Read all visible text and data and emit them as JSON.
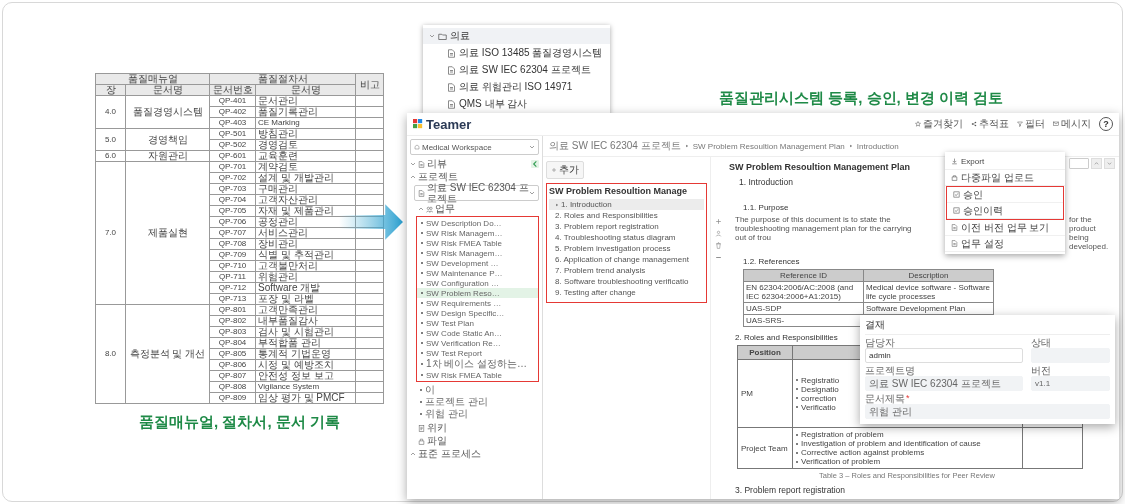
{
  "document_table": {
    "header_groups": [
      "품질매뉴얼",
      "품질절차서",
      "비고"
    ],
    "columns": [
      "장",
      "문서명",
      "문서번호",
      "문서명"
    ],
    "groups": [
      {
        "chapter": "4.0",
        "name": "품질경영시스템",
        "procedures": [
          {
            "number": "QP-401",
            "title": "문서관리"
          },
          {
            "number": "QP-402",
            "title": "품질기록관리"
          },
          {
            "number": "QP-403",
            "title": "CE Marking"
          }
        ]
      },
      {
        "chapter": "5.0",
        "name": "경영책임",
        "procedures": [
          {
            "number": "QP-501",
            "title": "방침관리"
          },
          {
            "number": "QP-502",
            "title": "경영검토"
          }
        ]
      },
      {
        "chapter": "6.0",
        "name": "자원관리",
        "procedures": [
          {
            "number": "QP-601",
            "title": "교육훈련"
          }
        ]
      },
      {
        "chapter": "7.0",
        "name": "제품실현",
        "procedures": [
          {
            "number": "QP-701",
            "title": "계약검토"
          },
          {
            "number": "QP-702",
            "title": "설계 및 개발관리"
          },
          {
            "number": "QP-703",
            "title": "구매관리"
          },
          {
            "number": "QP-704",
            "title": "고객자산관리"
          },
          {
            "number": "QP-705",
            "title": "자재 및 제품관리"
          },
          {
            "number": "QP-706",
            "title": "공정관리"
          },
          {
            "number": "QP-707",
            "title": "서비스관리"
          },
          {
            "number": "QP-708",
            "title": "장비관리"
          },
          {
            "number": "QP-709",
            "title": "식별 및 추적관리"
          },
          {
            "number": "QP-710",
            "title": "고객불만처리"
          },
          {
            "number": "QP-711",
            "title": "위험관리"
          },
          {
            "number": "QP-712",
            "title": "Software 개발"
          },
          {
            "number": "QP-713",
            "title": "포장 및 라벨"
          }
        ]
      },
      {
        "chapter": "8.0",
        "name": "측정분석 및 개선",
        "procedures": [
          {
            "number": "QP-801",
            "title": "고객만족관리"
          },
          {
            "number": "QP-802",
            "title": "내부품질감사"
          },
          {
            "number": "QP-803",
            "title": "검사 및 시험관리"
          },
          {
            "number": "QP-804",
            "title": "부적합품 관리"
          },
          {
            "number": "QP-805",
            "title": "통계적 기법운영"
          },
          {
            "number": "QP-806",
            "title": "시정 및 예방조치"
          },
          {
            "number": "QP-807",
            "title": "안전성 정보 보고"
          },
          {
            "number": "QP-808",
            "title": "Vigilance System"
          },
          {
            "number": "QP-809",
            "title": "임상 평가 및 PMCF"
          }
        ]
      }
    ]
  },
  "caption": "품질매뉴얼, 절차서, 문서 기록",
  "folder_popup": {
    "label": "의료",
    "expanded": true,
    "files": [
      "의료 ISO 13485 품질경영시스템",
      "의료 SW IEC 62304 프로젝트",
      "의료 위험관리 ISO 14971",
      "QMS 내부 감사"
    ]
  },
  "headline": "품질관리시스템 등록, 승인, 변경 이력 검토",
  "app": {
    "logo": "Teamer",
    "header_actions": [
      {
        "label": "즐겨찾기",
        "kind": "star"
      },
      {
        "label": "추적표",
        "kind": "share"
      },
      {
        "label": "필터",
        "kind": "filter"
      },
      {
        "label": "메시지",
        "kind": "message"
      }
    ],
    "help": "?",
    "sidebar": {
      "workspace": "Medical Workspace",
      "review": {
        "label": "리뷰",
        "expanded": false
      },
      "project": {
        "label": "프로젝트",
        "expanded": true,
        "select": "의료 SW IEC 62304 프로젝트"
      },
      "task": {
        "label": "업무",
        "expanded": true,
        "highlighted": true,
        "items": [
          {
            "label": "SW Description Do…",
            "selected": false
          },
          {
            "label": "SW Risk Managem…",
            "selected": false
          },
          {
            "label": "SW Risk FMEA Table",
            "selected": false
          },
          {
            "label": "SW Risk Managem…",
            "selected": false
          },
          {
            "label": "SW Development …",
            "selected": false
          },
          {
            "label": "SW Maintenance P…",
            "selected": false
          },
          {
            "label": "SW Configuration …",
            "selected": false
          },
          {
            "label": "SW Problem Reso…",
            "selected": true
          },
          {
            "label": "SW Requirements …",
            "selected": false
          },
          {
            "label": "SW Design Specific…",
            "selected": false
          },
          {
            "label": "SW Test Plan",
            "selected": false
          },
          {
            "label": "SW Code Static An…",
            "selected": false
          },
          {
            "label": "SW Verification Re…",
            "selected": false
          },
          {
            "label": "SW Test Report",
            "selected": false
          },
          {
            "label": "1차 베이스 설정하는…",
            "selected": false
          },
          {
            "label": "SW Risk FMEA Table",
            "selected": false
          }
        ],
        "more_items": [
          {
            "label": "이",
            "selected": false
          },
          {
            "label": "프로젝트 관리",
            "selected": false
          },
          {
            "label": "위험 관리",
            "selected": false
          }
        ]
      },
      "links": [
        {
          "label": "위키",
          "kind": "wiki"
        },
        {
          "label": "파일",
          "kind": "file"
        }
      ],
      "standard": {
        "label": "표준 프로세스",
        "expanded": true
      }
    },
    "breadcrumb": [
      "의료 SW IEC 62304 프로젝트",
      "SW Problem Resoultion Management Plan",
      "Introduction"
    ],
    "outline": {
      "add_button": "추가",
      "title": "SW Problem Resoultion Manage",
      "highlighted": true,
      "items": [
        {
          "label": "1. Introduction",
          "selected": true,
          "has_children": true
        },
        {
          "label": "2. Roles and Responsibilities",
          "selected": false,
          "has_children": false
        },
        {
          "label": "3. Problem report registration",
          "selected": false,
          "has_children": false
        },
        {
          "label": "4. Troubleshooting status diagram",
          "selected": false,
          "has_children": false
        },
        {
          "label": "5. Problem investigation process",
          "selected": false,
          "has_children": false
        },
        {
          "label": "6. Application of change management",
          "selected": false,
          "has_children": false
        },
        {
          "label": "7. Problem trend analysis",
          "selected": false,
          "has_children": false
        },
        {
          "label": "8. Software troubleshooting verificatio",
          "selected": false,
          "has_children": false
        },
        {
          "label": "9. Testing after change",
          "selected": false,
          "has_children": false
        }
      ]
    },
    "document": {
      "title": "SW Problem Resoultion Management Plan",
      "heading": "1. Introduction",
      "tools": [
        {
          "kind": "add"
        },
        {
          "kind": "person"
        },
        {
          "kind": "trash"
        },
        {
          "kind": "minus"
        }
      ],
      "purpose": {
        "heading": "1.1. Purpose",
        "text_before": "The purpose of this document is to state the troubleshooting management plan for the carrying out of trou",
        "text_after": "for the product being developed."
      },
      "references": {
        "heading": "1.2. References",
        "columns": [
          "Reference ID",
          "Description"
        ],
        "rows": [
          [
            "EN 62304:2006/AC:2008 (and IEC 62304:2006+A1:2015)",
            "Medical device software - Software life cycle processes"
          ],
          [
            "UAS-SDP",
            "Software Development Plan"
          ],
          [
            "UAS-SRS-"
          ]
        ]
      },
      "roles": {
        "heading": "2. Roles and Responsibilities",
        "columns": [
          "Position"
        ],
        "rows": [
          {
            "position": "PM",
            "items": [
              "Registratio",
              "Designatio",
              "correction",
              "Verificatio"
            ]
          },
          {
            "position": "Project Team",
            "items": [
              "Registration of problem",
              "Investigation of problem and identification of cause",
              "Corrective action against problems",
              "Verification of problem"
            ]
          }
        ],
        "caption": "Table 3 – Roles and Responsibilities for Peer Review"
      },
      "next_heading": "3. Problem report registration"
    },
    "menu": {
      "items": [
        {
          "label": "Export",
          "kind": "export",
          "highlighted": false
        },
        {
          "label": "다중파일 업로드",
          "kind": "upload",
          "highlighted": false
        },
        {
          "label": "승인",
          "kind": "check",
          "highlighted": true
        },
        {
          "label": "승인이력",
          "kind": "check",
          "highlighted": true
        },
        {
          "label": "이전 버전 업무 보기",
          "kind": "doc",
          "highlighted": false
        },
        {
          "label": "업무 설정",
          "kind": "doc",
          "highlighted": false
        }
      ]
    },
    "dialog": {
      "title": "결재",
      "fields": [
        {
          "label": "담당자",
          "value": "admin",
          "disabled": false
        },
        {
          "label": "상태",
          "disabled": true
        },
        {
          "label": "프로젝트명",
          "value": "의료 SW IEC 62304 프로젝트",
          "disabled": true
        },
        {
          "label": "버전",
          "value": "v1.1",
          "disabled": true
        },
        {
          "label": "문서제목",
          "required_mark": "*",
          "value": "위험 관리",
          "disabled": true
        }
      ]
    }
  }
}
